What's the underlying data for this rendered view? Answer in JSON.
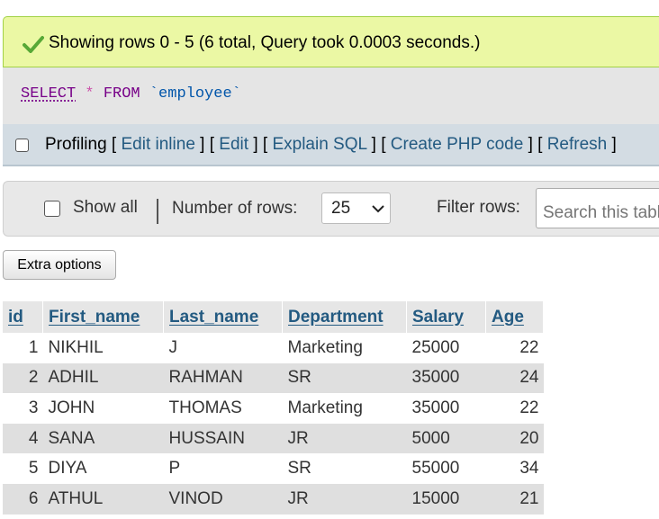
{
  "status": {
    "message": "Showing rows 0 - 5 (6 total, Query took 0.0003 seconds.)",
    "icon": "checkmark-icon",
    "color": "#57a836"
  },
  "query": {
    "select": "SELECT",
    "star": "*",
    "from": "FROM",
    "table": "`employee`"
  },
  "links": {
    "profiling": "Profiling",
    "items": [
      "Edit inline",
      "Edit",
      "Explain SQL",
      "Create PHP code",
      "Refresh"
    ]
  },
  "nav": {
    "show_all": "Show all",
    "rows_label": "Number of rows:",
    "rows_value": "25",
    "filter_label": "Filter rows:",
    "search_placeholder": "Search this table"
  },
  "extra_options": "Extra options",
  "table": {
    "columns": [
      "id",
      "First_name",
      "Last_name",
      "Department",
      "Salary",
      "Age"
    ],
    "rows": [
      [
        "1",
        "NIKHIL",
        "J",
        "Marketing",
        "25000",
        "22"
      ],
      [
        "2",
        "ADHIL",
        "RAHMAN",
        "SR",
        "35000",
        "24"
      ],
      [
        "3",
        "JOHN",
        "THOMAS",
        "Marketing",
        "35000",
        "22"
      ],
      [
        "4",
        "SANA",
        "HUSSAIN",
        "JR",
        "5000",
        "20"
      ],
      [
        "5",
        "DIYA",
        "P",
        "SR",
        "55000",
        "34"
      ],
      [
        "6",
        "ATHUL",
        "VINOD",
        "JR",
        "15000",
        "21"
      ]
    ]
  }
}
